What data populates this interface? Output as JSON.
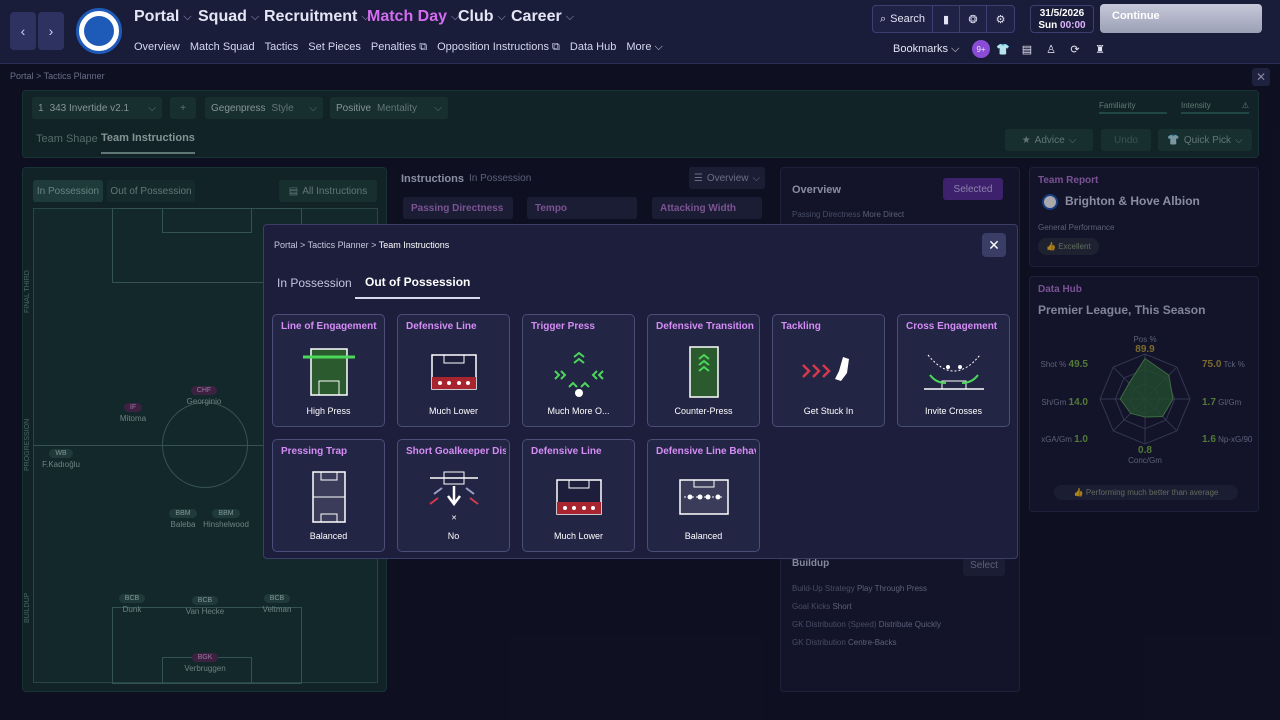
{
  "topnav": {
    "main": [
      {
        "label": "Portal",
        "active": false
      },
      {
        "label": "Squad",
        "active": false
      },
      {
        "label": "Recruitment",
        "active": false
      },
      {
        "label": "Match Day",
        "active": true
      },
      {
        "label": "Club",
        "active": false
      },
      {
        "label": "Career",
        "active": false
      }
    ],
    "sub": [
      "Overview",
      "Match Squad",
      "Tactics",
      "Set Pieces",
      "Penalties",
      "Opposition Instructions",
      "Data Hub",
      "More"
    ],
    "search_label": "Search",
    "date": "31/5/2026",
    "day": "Sun",
    "time": "00:00",
    "continue_label": "Continue",
    "bookmarks_label": "Bookmarks",
    "notification_badge": "9+"
  },
  "breadcrumb": "Portal  >  Tactics Planner",
  "toolbar": {
    "tactic_num": "1",
    "tactic_name": "343 Invertide v2.1",
    "add": "+",
    "style_value": "Gegenpress",
    "style_label": "Style",
    "mentality_value": "Positive",
    "mentality_label": "Mentality",
    "familiarity": "Familiarity",
    "intensity": "Intensity",
    "tabs": [
      "Team Shape",
      "Team Instructions"
    ],
    "advice": "Advice",
    "undo": "Undo",
    "quick_pick": "Quick Pick"
  },
  "pitch": {
    "tabs": [
      "In Possession",
      "Out of Possession"
    ],
    "all_instructions": "All Instructions",
    "thirds": [
      "FINAL THIRD",
      "PROGRESSION",
      "BUILDUP"
    ],
    "players": [
      {
        "pos": "CHF",
        "name": "Georginio",
        "pink": true
      },
      {
        "pos": "IF",
        "name": "Mitoma",
        "pink": true
      },
      {
        "pos": "WB",
        "name": "F.Kadıoğlu",
        "pink": false
      },
      {
        "pos": "BBM",
        "name": "Baleba",
        "pink": false
      },
      {
        "pos": "BBM",
        "name": "Hinshelwood",
        "pink": false
      },
      {
        "pos": "BCB",
        "name": "Dunk",
        "pink": false
      },
      {
        "pos": "BCB",
        "name": "Van Hecke",
        "pink": false
      },
      {
        "pos": "BCB",
        "name": "Veltman",
        "pink": false
      },
      {
        "pos": "BGK",
        "name": "Verbruggen",
        "pink": true
      }
    ]
  },
  "instructions": {
    "title": "Instructions",
    "subtitle": "In Possession",
    "view": "Overview",
    "cards": [
      "Passing Directness",
      "Tempo",
      "Attacking Width"
    ]
  },
  "overview": {
    "title": "Overview",
    "selected": "Selected",
    "row1_label": "Passing Directness",
    "row1_value": "More Direct",
    "buildup_title": "Buildup",
    "buildup_select": "Select",
    "buildup_rows": [
      {
        "label": "Build-Up Strategy",
        "value": "Play Through Press"
      },
      {
        "label": "Goal Kicks",
        "value": "Short"
      },
      {
        "label": "GK Distribution (Speed)",
        "value": "Distribute Quickly"
      },
      {
        "label": "GK Distribution",
        "value": "Centre-Backs"
      }
    ]
  },
  "team_report": {
    "title": "Team Report",
    "club": "Brighton & Hove Albion",
    "perf_label": "General Performance",
    "perf_value": "Excellent"
  },
  "data_hub": {
    "title": "Data Hub",
    "subtitle": "Premier League, This Season",
    "stats": [
      {
        "label": "Pos %",
        "value": "89.9"
      },
      {
        "label": "Tck %",
        "value": "75.0"
      },
      {
        "label": "Gl/Gm",
        "value": "1.7"
      },
      {
        "label": "Np-xG/90",
        "value": "1.6"
      },
      {
        "label": "Conc/Gm",
        "value": "0.8"
      },
      {
        "label": "xGA/Gm",
        "value": "1.0"
      },
      {
        "label": "Sh/Gm",
        "value": "14.0"
      },
      {
        "label": "Shot %",
        "value": "49.5"
      }
    ],
    "radar_levels": [
      0.9,
      0.75,
      0.62,
      0.55,
      0.4,
      0.45,
      0.55,
      0.5
    ],
    "footer": "Performing much better than average",
    "colors": {
      "radar_fill": "#2f6b3a",
      "value_good": "#7ab648",
      "value_mid": "#b7a03a"
    }
  },
  "modal": {
    "crumb": [
      "Portal",
      "Tactics Planner",
      "Team Instructions"
    ],
    "tabs": [
      "In Possession",
      "Out of Possession"
    ],
    "cards": [
      {
        "title": "Line of Engagement",
        "value": "High Press"
      },
      {
        "title": "Defensive Line",
        "value": "Much Lower"
      },
      {
        "title": "Trigger Press",
        "value": "Much More O..."
      },
      {
        "title": "Defensive Transition",
        "value": "Counter-Press"
      },
      {
        "title": "Tackling",
        "value": "Get Stuck In"
      },
      {
        "title": "Cross Engagement",
        "value": "Invite Crosses"
      },
      {
        "title": "Pressing Trap",
        "value": "Balanced"
      },
      {
        "title": "Short Goalkeeper Distribution",
        "value": "No"
      },
      {
        "title": "Defensive Line",
        "value": "Much Lower"
      },
      {
        "title": "Defensive Line Behaviour",
        "value": "Balanced"
      }
    ],
    "colors": {
      "title": "#d58cf5",
      "accent_green": "#4cd65a",
      "accent_red": "#d63a4a"
    }
  }
}
